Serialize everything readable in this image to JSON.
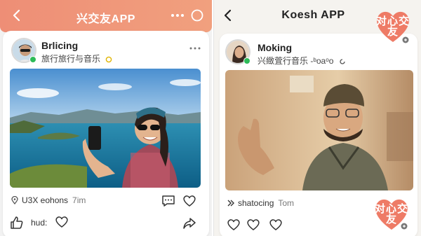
{
  "left_screen": {
    "app_title": "兴交友APP",
    "post": {
      "username": "Brlicing",
      "subtitle": "旅行旅行与音乐",
      "location_text": "U3X eohons",
      "time": "7im",
      "like_label": "hud:"
    }
  },
  "right_screen": {
    "app_title": "Koesh APP",
    "badge_text": "对心交友",
    "post": {
      "username": "Moking",
      "subtitle": "兴緻萓行音乐 -ᵇoaᵒo",
      "share_text": "shatocing",
      "share_user": "Tom"
    }
  },
  "colors": {
    "left_header_gradient_start": "#ee8e76",
    "left_header_gradient_end": "#f1a07e",
    "badge": "#ee7b66",
    "verified": "#2dbb58"
  },
  "icons": [
    "back-icon",
    "more-icon",
    "circle-icon",
    "verified-icon",
    "location-pin-icon",
    "comment-icon",
    "heart-icon",
    "thumbs-up-icon",
    "share-icon",
    "forward-arrow-icon",
    "settings-dot-icon"
  ]
}
